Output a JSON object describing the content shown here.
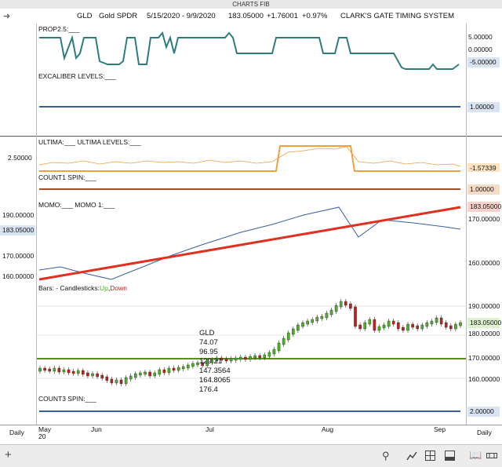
{
  "window_title": "CHARTS FIB",
  "header": {
    "symbol": "GLD",
    "name": "Gold SPDR",
    "date_range": "5/15/2020 - 9/9/2020",
    "price": "183.05000",
    "change": "+1.76001",
    "change_pct": "+0.97%",
    "system": "CLARK'S GATE TIMING SYSTEM"
  },
  "panels": {
    "prop": {
      "label": "PROP2.5:___",
      "ticks": [
        "5.00000",
        "0.00000",
        "-5.00000"
      ],
      "value_tag": "-5.00000"
    },
    "excaliber": {
      "label": "EXCALIBER LEVELS:___",
      "value_tag": "1.00000"
    },
    "ultima": {
      "label": "ULTIMA:___   ULTIMA LEVELS:___",
      "left_tick": "2.50000",
      "value_tag": "-1.57339"
    },
    "count1": {
      "label": "COUNT1 SPIN:___",
      "value_tag": "1.00000"
    },
    "momo": {
      "label": "MOMO:___   MOMO 1:___",
      "ticks": [
        "190.00000",
        "180.00000",
        "170.00000",
        "160.00000"
      ],
      "right_ticks": [
        "170.00000",
        "160.00000"
      ],
      "value_tag": "183.05000",
      "left_tag": "183.05000"
    },
    "bars": {
      "label_prefix": "Bars:",
      "label_mid": " - Candlesticks:",
      "up": "Up",
      "sep": ",",
      "down": "Down",
      "ticks": [
        "190.00000",
        "180.00000",
        "170.00000",
        "160.00000"
      ],
      "value_tag": "183.05000"
    },
    "count3": {
      "label": "COUNT3 SPIN:___",
      "value_tag": "2.00000"
    }
  },
  "tooltip": {
    "symbol": "GLD",
    "lines": [
      "74.07",
      "96.95",
      "129.21",
      "147.3564",
      "164.8065",
      "176.4"
    ]
  },
  "xaxis": {
    "left": "Daily",
    "right": "Daily",
    "months": [
      "May",
      "Jun",
      "Jul",
      "Aug",
      "Sep"
    ],
    "year": "20"
  },
  "colors": {
    "teal": "#2e7d7d",
    "blue": "#3a5fa0",
    "orange": "#f0a040",
    "brown": "#a0522d",
    "red": "#e03020",
    "green": "#5a8f1f",
    "up": "#4caf28",
    "down": "#c0201a"
  },
  "icons": [
    "add-icon",
    "search-icon",
    "line-chart-icon",
    "grid-icon",
    "panel-icon",
    "book-icon",
    "zoom-icon"
  ]
}
